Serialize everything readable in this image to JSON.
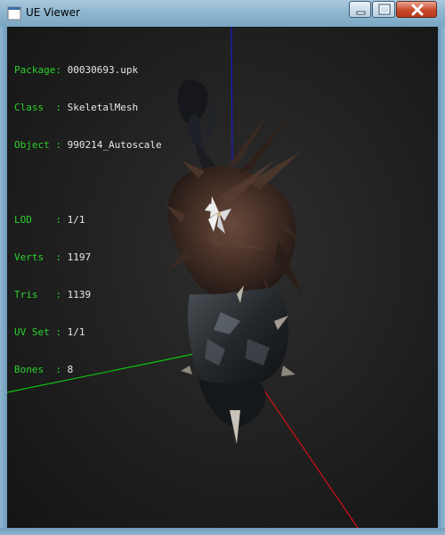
{
  "window": {
    "title": "UE Viewer"
  },
  "hud": {
    "rows": [
      {
        "key": "Package",
        "value": "00030693.upk"
      },
      {
        "key": "Class  ",
        "value": "SkeletalMesh"
      },
      {
        "key": "Object ",
        "value": "990214_Autoscale"
      },
      {
        "key": "LOD    ",
        "value": "1/1"
      },
      {
        "key": "Verts  ",
        "value": "1197"
      },
      {
        "key": "Tris   ",
        "value": "1139"
      },
      {
        "key": "UV Set ",
        "value": "1/1"
      },
      {
        "key": "Bones  ",
        "value": "8"
      }
    ]
  },
  "colors": {
    "hud_key": "#2bd12b",
    "hud_value": "#e8e8e8",
    "axis_x": "#d01010",
    "axis_y": "#10c010",
    "axis_z": "#1a1ad0",
    "viewport_bg": "#222222"
  },
  "icons": {
    "app": "app-icon",
    "minimize": "minimize-icon",
    "maximize": "maximize-icon",
    "close": "close-icon"
  }
}
